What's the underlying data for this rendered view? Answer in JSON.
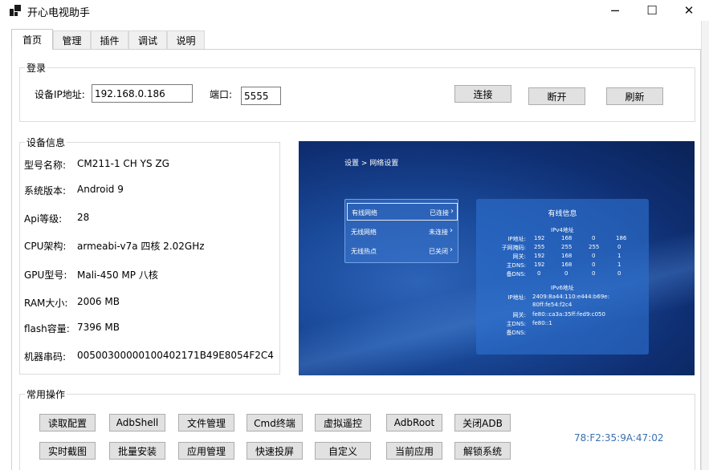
{
  "window": {
    "title": "开心电视助手",
    "controls": {
      "minimize": "─",
      "maximize": "☐",
      "close": "✕"
    }
  },
  "tabs": [
    {
      "label": "首页",
      "active": true
    },
    {
      "label": "管理"
    },
    {
      "label": "插件"
    },
    {
      "label": "调试"
    },
    {
      "label": "说明"
    }
  ],
  "login": {
    "group_title": "登录",
    "ip_label": "设备IP地址:",
    "ip_value": "192.168.0.186",
    "port_label": "端口:",
    "port_value": "5555",
    "connect": "连接",
    "disconnect": "断开",
    "refresh": "刷新"
  },
  "device_info": {
    "group_title": "设备信息",
    "rows": [
      {
        "label": "型号名称:",
        "value": "CM211-1 CH YS ZG"
      },
      {
        "label": "系统版本:",
        "value": "Android 9"
      },
      {
        "label": "Api等级:",
        "value": "28"
      },
      {
        "label": "CPU架构:",
        "value": "armeabi-v7a 四核 2.02GHz"
      },
      {
        "label": "GPU型号:",
        "value": "Mali-450 MP 八核"
      },
      {
        "label": "RAM大小:",
        "value": "2006 MB"
      },
      {
        "label": "flash容量:",
        "value": "7396 MB"
      },
      {
        "label": "机器串码:",
        "value": "00500300000100402171B49E8054F2C4"
      }
    ]
  },
  "tv_screen": {
    "breadcrumb": "设置 > 网络设置",
    "menu": [
      {
        "label": "有线网络",
        "status": "已连接",
        "selected": true
      },
      {
        "label": "无线网络",
        "status": "未连接"
      },
      {
        "label": "无线热点",
        "status": "已关闭"
      }
    ],
    "card_title": "有线信息",
    "ipv4_title": "IPv4地址",
    "ipv4_rows": [
      {
        "label": "IP地址:",
        "values": [
          "192",
          "168",
          "0",
          "186"
        ]
      },
      {
        "label": "子网掩码:",
        "values": [
          "255",
          "255",
          "255",
          "0"
        ]
      },
      {
        "label": "网关:",
        "values": [
          "192",
          "168",
          "0",
          "1"
        ]
      },
      {
        "label": "主DNS:",
        "values": [
          "192",
          "168",
          "0",
          "1"
        ]
      },
      {
        "label": "备DNS:",
        "values": [
          "0",
          "0",
          "0",
          "0"
        ]
      }
    ],
    "ipv6_title": "IPv6地址",
    "ipv6_rows": [
      {
        "label": "IP地址:",
        "value": "2409:8a44:110:e444:b69e:",
        "value2": "80ff:fe54:f2c4"
      },
      {
        "label": "网关:",
        "value": "fe80::ca3a:35ff:fed9:c050"
      },
      {
        "label": "主DNS:",
        "value": "fe80::1"
      },
      {
        "label": "备DNS:",
        "value": ""
      }
    ],
    "colors": {
      "bg": "#123a85",
      "card": "#2f6ecd"
    }
  },
  "ops": {
    "group_title": "常用操作",
    "row1": [
      "读取配置",
      "AdbShell",
      "文件管理",
      "Cmd终端",
      "虚拟遥控",
      "AdbRoot",
      "关闭ADB"
    ],
    "row2": [
      "实时截图",
      "批量安装",
      "应用管理",
      "快速投屏",
      "自定义",
      "当前应用",
      "解锁系统"
    ],
    "mac": "78:F2:35:9A:47:02"
  }
}
